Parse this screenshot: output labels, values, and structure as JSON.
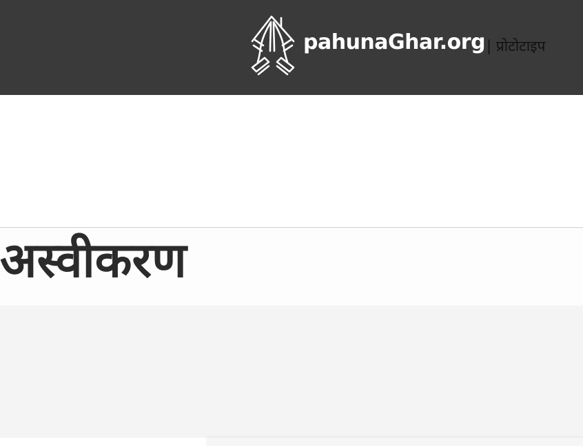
{
  "header": {
    "logo_text": "pahunaGhar.org",
    "logo_suffix": "| प्रोटोटाइप",
    "logo_icon": "namaste-hands-house-icon",
    "background_color": "#3a3a3a"
  },
  "page": {
    "title": "अस्वीकरण"
  },
  "colors": {
    "title_text": "#2b2b2b",
    "content_background": "#f4f4f4"
  }
}
